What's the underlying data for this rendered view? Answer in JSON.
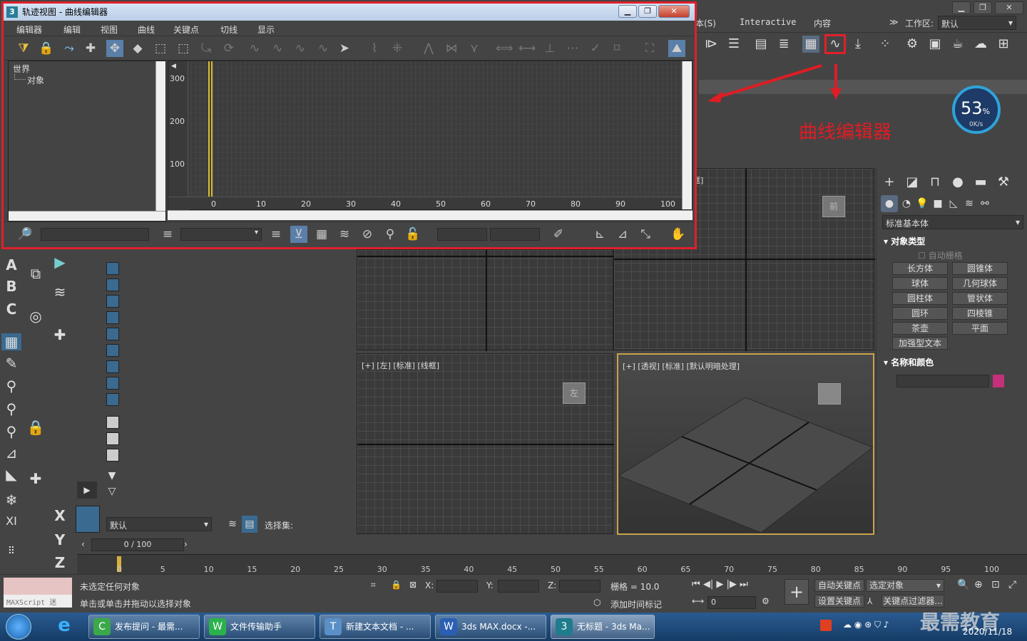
{
  "trackview": {
    "title": "轨迹视图 - 曲线编辑器",
    "app_icon_glyph": "3",
    "menu": [
      "编辑器",
      "编辑",
      "视图",
      "曲线",
      "关键点",
      "切线",
      "显示"
    ],
    "tree": {
      "root": "世界",
      "child": "对象"
    },
    "y_ticks": [
      "300",
      "200",
      "100"
    ],
    "x_ticks": [
      "0",
      "10",
      "20",
      "30",
      "40",
      "50",
      "60",
      "70",
      "80",
      "90",
      "100"
    ]
  },
  "topmenu": {
    "items": [
      "本(S)",
      "Interactive",
      "内容"
    ],
    "workspace_label": "工作区:",
    "workspace_value": "默认",
    "chevron": "≫"
  },
  "annotation": {
    "text": "曲线编辑器",
    "color": "#e01c24"
  },
  "gauge": {
    "percent": "53",
    "percent_unit": "%",
    "rate": "0K/s"
  },
  "cmdpanel": {
    "dropdown": "标准基本体",
    "section_object_type": "对象类型",
    "auto_grid": "自动栅格",
    "buttons": [
      "长方体",
      "圆锥体",
      "球体",
      "几何球体",
      "圆柱体",
      "管状体",
      "圆环",
      "四棱锥",
      "茶壶",
      "平面",
      "加强型文本"
    ],
    "section_name_color": "名称和颜色",
    "swatch_color": "#c4307a"
  },
  "viewports": {
    "left_label": "[+] [左] [标准] [线框]",
    "persp_label": "[+] [透视] [标准] [默认明暗处理]",
    "top_label_fragment": "框]",
    "cube_front": "前",
    "cube_left": "左"
  },
  "leftbar": {
    "letters": [
      "A",
      "B",
      "C"
    ],
    "xyz": [
      "X",
      "Y",
      "Z"
    ],
    "xi": "XI"
  },
  "layer": {
    "value": "默认",
    "selection_set": "选择集:"
  },
  "timeline": {
    "frame": "0 / 100",
    "ticks": [
      "0",
      "5",
      "10",
      "15",
      "20",
      "25",
      "30",
      "35",
      "40",
      "45",
      "50",
      "55",
      "60",
      "65",
      "70",
      "75",
      "80",
      "85",
      "90",
      "95",
      "100"
    ]
  },
  "status": {
    "maxscript": "MAXScript 迷",
    "line1": "未选定任何对象",
    "line2": "单击或单击并拖动以选择对象",
    "x_label": "X:",
    "y_label": "Y:",
    "z_label": "Z:",
    "grid": "栅格 = 10.0",
    "add_time_tag": "添加时间标记",
    "auto_key": "自动关键点",
    "selected": "选定对象",
    "set_key": "设置关键点",
    "key_filter": "关键点过滤器...",
    "frame_spinner": "0"
  },
  "taskbar": {
    "tasks": [
      {
        "label": "发布提问 - 最需...",
        "color": "#3aa94a",
        "glyph": "C"
      },
      {
        "label": "文件传输助手",
        "color": "#2bb24c",
        "glyph": "W"
      },
      {
        "label": "新建文本文档 - ...",
        "color": "#5b8fc7",
        "glyph": "T"
      },
      {
        "label": "3ds MAX.docx -...",
        "color": "#2b5fb4",
        "glyph": "W"
      },
      {
        "label": "无标题 - 3ds Ma...",
        "color": "#1e7c8c",
        "glyph": "3"
      }
    ],
    "date": "2020/11/18",
    "watermark": "最需教育"
  }
}
